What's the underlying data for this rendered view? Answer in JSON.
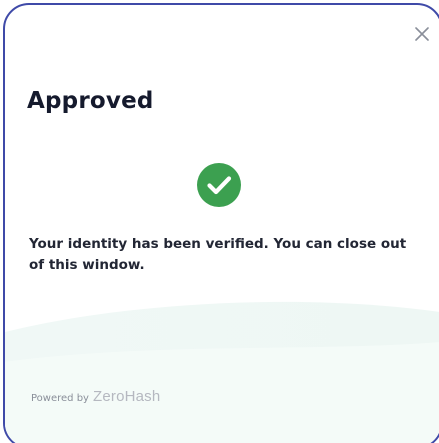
{
  "modal": {
    "title": "Approved",
    "message": "Your identity has been verified. You can close out of this window.",
    "close_icon": "close-icon",
    "status_icon": "check-circle-icon"
  },
  "footer": {
    "powered_by": "Powered by",
    "brand_name": "ZeroHash"
  },
  "colors": {
    "border": "#3f4aa8",
    "success": "#3ca050",
    "title": "#151a2d",
    "text": "#222634",
    "muted": "#8a8f9a"
  }
}
